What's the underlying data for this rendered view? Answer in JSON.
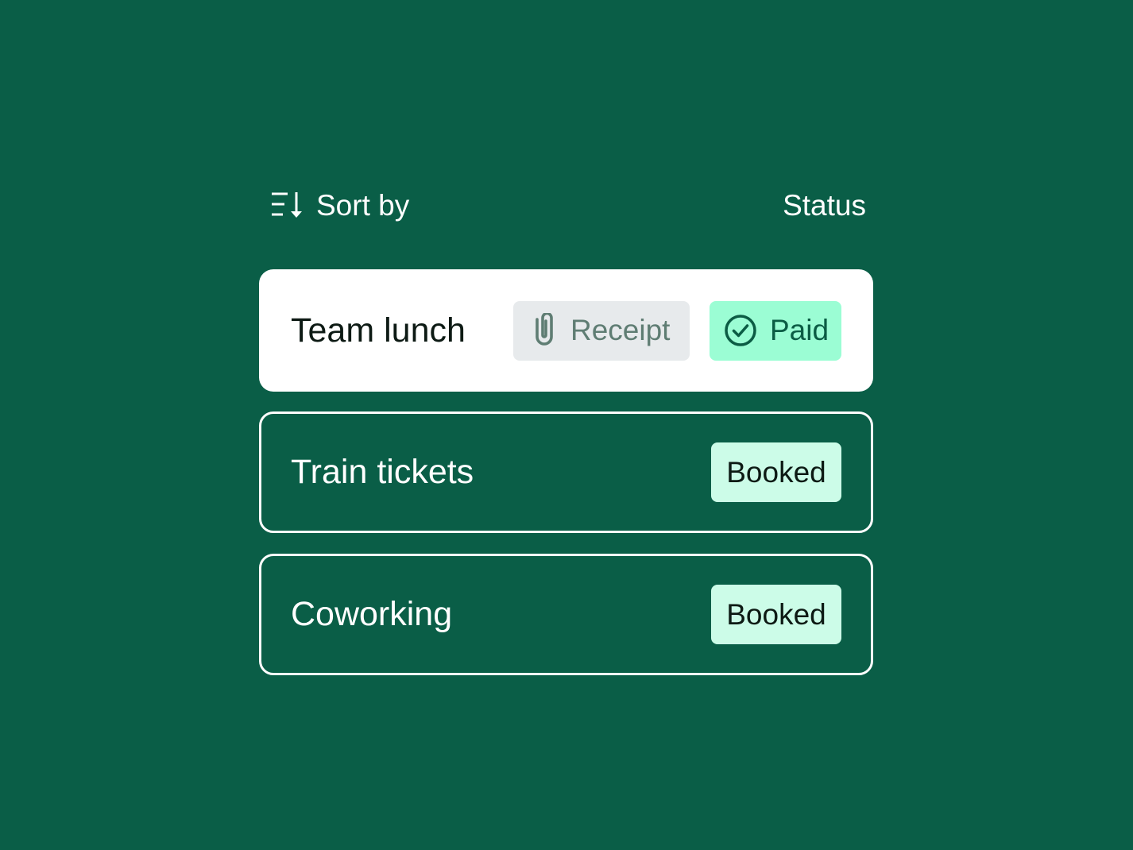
{
  "sort_bar": {
    "sort_label": "Sort by",
    "sort_icon": "sort-descending-icon",
    "status_label": "Status"
  },
  "items": [
    {
      "title": "Team lunch",
      "attachment_label": "Receipt",
      "attachment_icon": "paperclip-icon",
      "status": "Paid",
      "status_icon": "check-circle-icon"
    },
    {
      "title": "Train tickets",
      "status": "Booked"
    },
    {
      "title": "Coworking",
      "status": "Booked"
    }
  ],
  "colors": {
    "background": "#0a5e47",
    "card_active": "#ffffff",
    "receipt_chip": "#e7eaec",
    "paid_chip": "#9bfdd4",
    "booked_chip": "#ccfce8"
  }
}
